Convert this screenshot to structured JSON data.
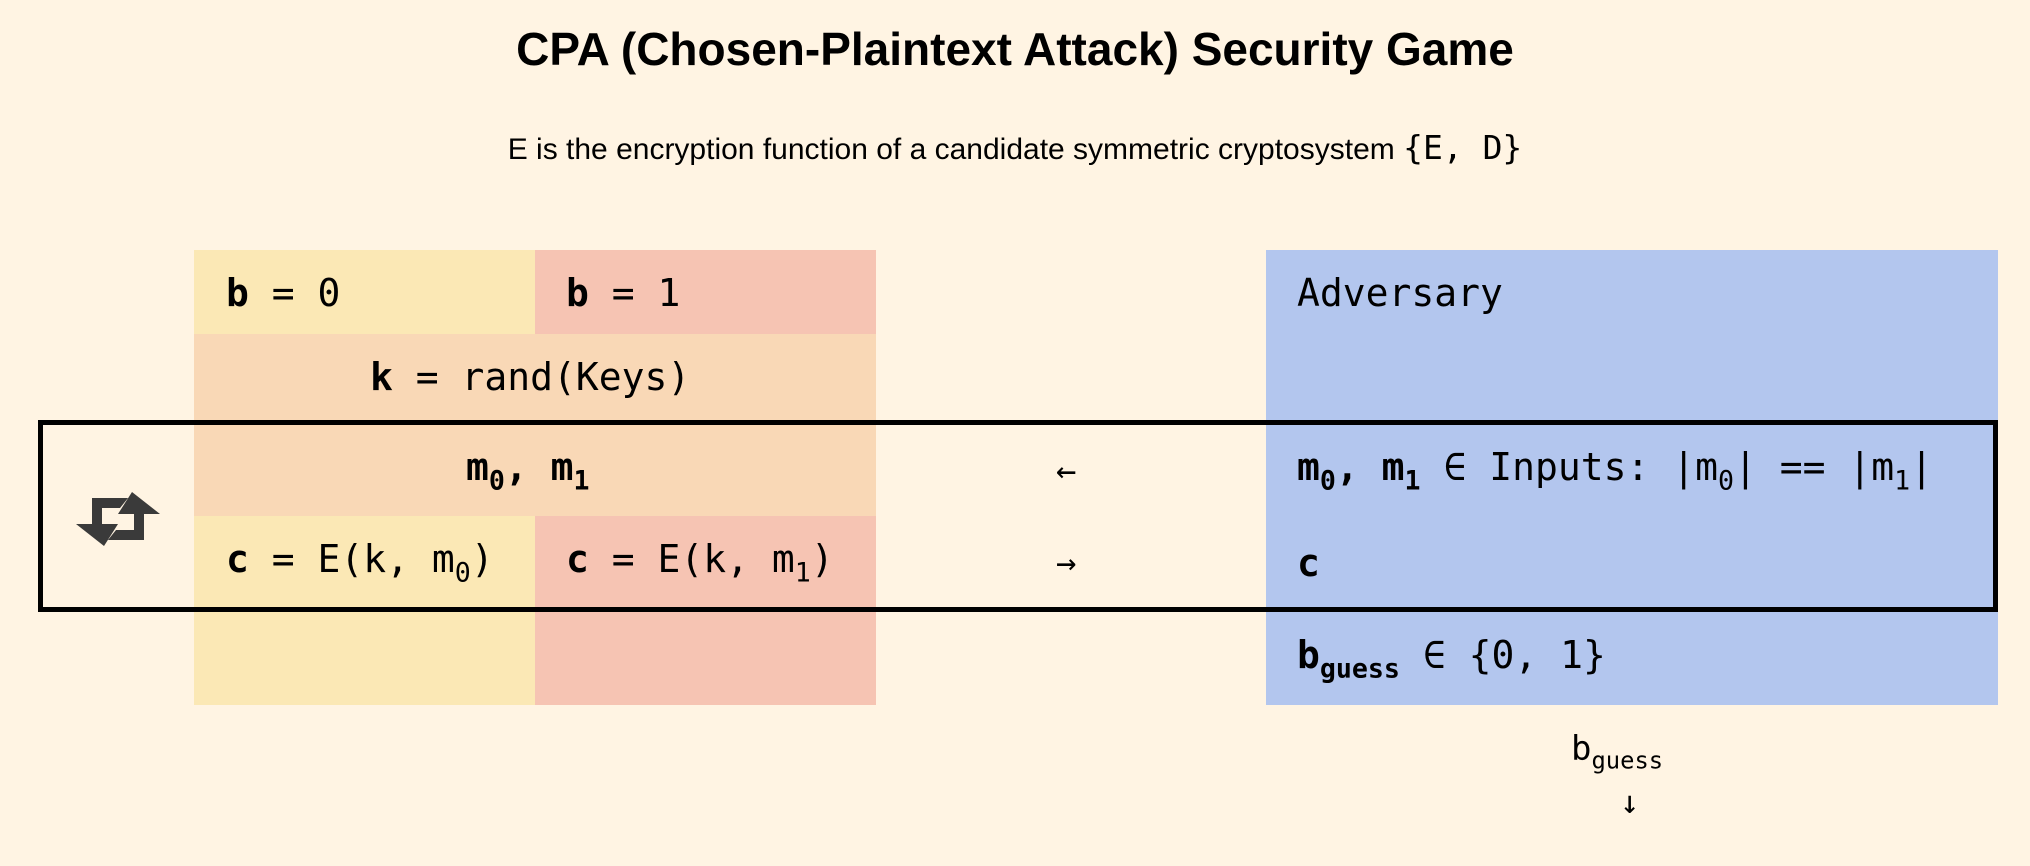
{
  "title": "CPA (Chosen-Plaintext Attack) Security Game",
  "subtitle": {
    "pre": "E",
    "text": " is the encryption function of a candidate symmetric cryptosystem ",
    "set": "{E, D}"
  },
  "challenger": {
    "b0_var": "b",
    "b0_rest": " = 0",
    "b1_var": "b",
    "b1_rest": " = 1",
    "key_var": "k",
    "key_rest": " = rand(Keys)",
    "msgs_m": "m",
    "msgs_sub0": "0",
    "msgs_sep": ", m",
    "msgs_sub1": "1",
    "c0_var": "c",
    "c0_rest": " = E(k, m",
    "c0_sub": "0",
    "c0_close": ")",
    "c1_var": "c",
    "c1_rest": " = E(k, m",
    "c1_sub": "1",
    "c1_close": ")"
  },
  "arrows": {
    "left": "←",
    "right": "→",
    "down": "↓"
  },
  "adversary": {
    "name": "Adversary",
    "msgs_m": "m",
    "msgs_sub0": "0",
    "msgs_sep": ", m",
    "msgs_sub1": "1",
    "msgs_rest_a": " ∈ Inputs: |m",
    "msgs_rest_sub0": "0",
    "msgs_rest_b": "| == |m",
    "msgs_rest_sub1": "1",
    "msgs_rest_c": "|",
    "c_var": "c",
    "guess_var": "b",
    "guess_sub": "guess",
    "guess_rest": " ∈ {0, 1}"
  },
  "output": {
    "var": "b",
    "sub": "guess"
  },
  "icons": {
    "loop": "repeat-icon"
  },
  "colors": {
    "background": "#fff4e3",
    "b0": "#fbe8b5",
    "b1": "#f6c4b3",
    "shared": "#f9d8b6",
    "adversary": "#b3c6ee"
  }
}
